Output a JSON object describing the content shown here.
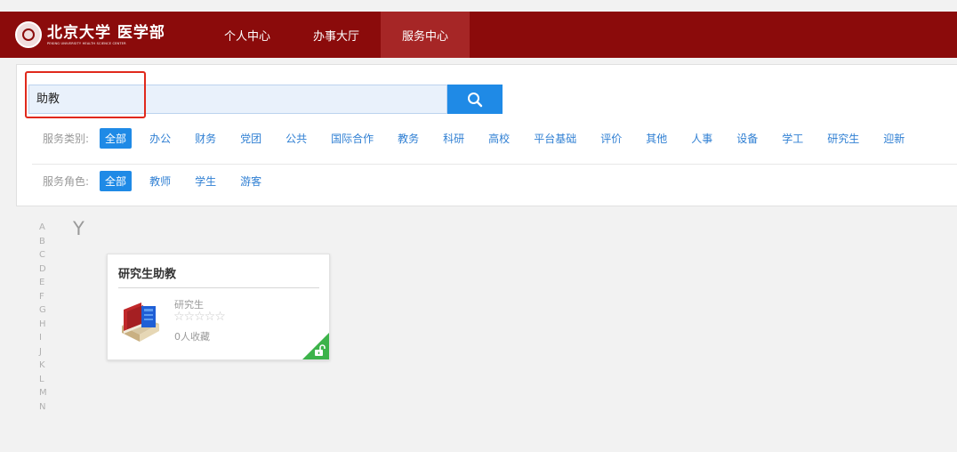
{
  "header": {
    "logo_cn": "北京大学 医学部",
    "logo_en": "PEKING UNIVERSITY HEALTH SCIENCE CENTER",
    "nav": [
      "个人中心",
      "办事大厅",
      "服务中心"
    ],
    "active_nav": "服务中心",
    "brand_color": "#8b0b0b"
  },
  "search": {
    "value": "助教",
    "button_icon": "search-icon",
    "accent": "#1f8ae6"
  },
  "filters": {
    "category_label": "服务类别:",
    "categories": [
      "全部",
      "办公",
      "财务",
      "党团",
      "公共",
      "国际合作",
      "教务",
      "科研",
      "高校",
      "平台基础",
      "评价",
      "其他",
      "人事",
      "设备",
      "学工",
      "研究生",
      "迎新"
    ],
    "role_label": "服务角色:",
    "roles": [
      "全部",
      "教师",
      "学生",
      "游客"
    ],
    "selected": "全部"
  },
  "alphabet": [
    "A",
    "B",
    "C",
    "D",
    "E",
    "F",
    "G",
    "H",
    "I",
    "J",
    "K",
    "L",
    "M",
    "N"
  ],
  "section_letter": "Y",
  "results": [
    {
      "title": "研究生助教",
      "category": "研究生",
      "stars": "☆☆☆☆☆",
      "rating": 0,
      "favorites": "0人收藏",
      "icon": "book-icon",
      "badge_icon": "unlock-icon",
      "badge_color": "#3cb34a"
    }
  ]
}
